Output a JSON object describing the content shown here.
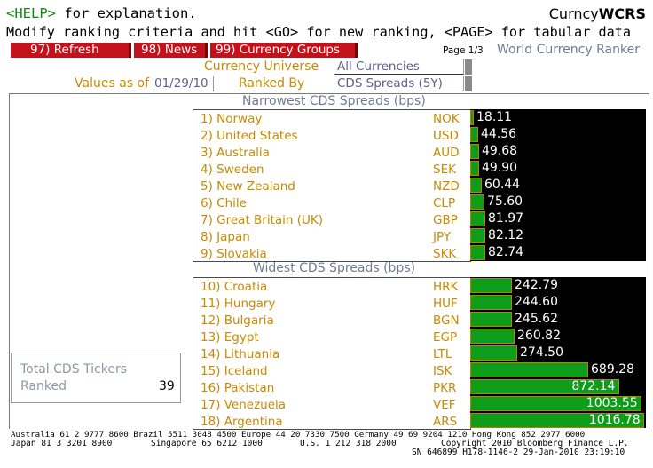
{
  "header": {
    "help_key": "<HELP>",
    "help_rest": " for explanation.",
    "function_prefix": "Curncy",
    "function_code": "WCRS",
    "line2": "Modify ranking criteria and hit <GO> for new ranking, <PAGE> for tabular data"
  },
  "toolbar": {
    "refresh": "97) Refresh",
    "news": "98) News",
    "groups": "99) Currency Groups",
    "page": "Page 1/3",
    "title": "World Currency Ranker"
  },
  "controls": {
    "universe_label": "Currency Universe",
    "universe_value": "All Currencies",
    "values_as_of_label": "Values as of",
    "date_value": "01/29/10",
    "ranked_by_label": "Ranked By",
    "ranked_by_value": "CDS Spreads (5Y)"
  },
  "narrowest": {
    "title": "Narrowest CDS Spreads  (bps)",
    "rows": [
      {
        "rank": "1) Norway",
        "code": "NOK",
        "value": 18.11,
        "label": "18.11"
      },
      {
        "rank": "2) United States",
        "code": "USD",
        "value": 44.56,
        "label": "44.56"
      },
      {
        "rank": "3) Australia",
        "code": "AUD",
        "value": 49.68,
        "label": "49.68"
      },
      {
        "rank": "4) Sweden",
        "code": "SEK",
        "value": 49.9,
        "label": "49.90"
      },
      {
        "rank": "5) New Zealand",
        "code": "NZD",
        "value": 60.44,
        "label": "60.44"
      },
      {
        "rank": "6) Chile",
        "code": "CLP",
        "value": 75.6,
        "label": "75.60"
      },
      {
        "rank": "7) Great Britain (UK)",
        "code": "GBP",
        "value": 81.97,
        "label": "81.97"
      },
      {
        "rank": "8) Japan",
        "code": "JPY",
        "value": 82.12,
        "label": "82.12"
      },
      {
        "rank": "9) Slovakia",
        "code": "SKK",
        "value": 82.74,
        "label": "82.74"
      }
    ]
  },
  "widest": {
    "title": "Widest CDS Spreads  (bps)",
    "rows": [
      {
        "rank": "10) Croatia",
        "code": "HRK",
        "value": 242.79,
        "label": "242.79"
      },
      {
        "rank": "11) Hungary",
        "code": "HUF",
        "value": 244.6,
        "label": "244.60"
      },
      {
        "rank": "12) Bulgaria",
        "code": "BGN",
        "value": 245.62,
        "label": "245.62"
      },
      {
        "rank": "13) Egypt",
        "code": "EGP",
        "value": 260.82,
        "label": "260.82"
      },
      {
        "rank": "14) Lithuania",
        "code": "LTL",
        "value": 274.5,
        "label": "274.50"
      },
      {
        "rank": "15) Iceland",
        "code": "ISK",
        "value": 689.28,
        "label": "689.28"
      },
      {
        "rank": "16) Pakistan",
        "code": "PKR",
        "value": 872.14,
        "label": "872.14"
      },
      {
        "rank": "17) Venezuela",
        "code": "VEF",
        "value": 1003.55,
        "label": "1003.55"
      },
      {
        "rank": "18) Argentina",
        "code": "ARS",
        "value": 1016.78,
        "label": "1016.78"
      }
    ]
  },
  "summary": {
    "label_line1": "Total CDS Tickers",
    "label_line2": "Ranked",
    "count": "39"
  },
  "footer": {
    "line1": "Australia 61 2 9777 8600 Brazil 5511 3048 4500 Europe 44 20 7330 7500 Germany 49 69 9204 1210 Hong Kong 852 2977 6000",
    "line2a": "Japan 81 3 3201 8900",
    "line2b": "Singapore 65 6212 1000",
    "line2c": "U.S. 1 212 318 2000",
    "line2d": "Copyright 2010 Bloomberg Finance L.P.",
    "line3": "SN 646899 H178-1146-2 29-Jan-2010 23:19:10"
  },
  "colors": {
    "bar_fill": "#0e9d1a",
    "bar_border": "#b58300",
    "bar_bg": "#000000",
    "button_bg": "#c4121d",
    "label_amber": "#c98a00"
  },
  "chart_data": [
    {
      "type": "bar",
      "title": "Narrowest CDS Spreads  (bps)",
      "categories": [
        "Norway",
        "United States",
        "Australia",
        "Sweden",
        "New Zealand",
        "Chile",
        "Great Britain (UK)",
        "Japan",
        "Slovakia"
      ],
      "values": [
        18.11,
        44.56,
        49.68,
        49.9,
        60.44,
        75.6,
        81.97,
        82.12,
        82.74
      ]
    },
    {
      "type": "bar",
      "title": "Widest CDS Spreads  (bps)",
      "categories": [
        "Croatia",
        "Hungary",
        "Bulgaria",
        "Egypt",
        "Lithuania",
        "Iceland",
        "Pakistan",
        "Venezuela",
        "Argentina"
      ],
      "values": [
        242.79,
        244.6,
        245.62,
        260.82,
        274.5,
        689.28,
        872.14,
        1003.55,
        1016.78
      ]
    }
  ]
}
